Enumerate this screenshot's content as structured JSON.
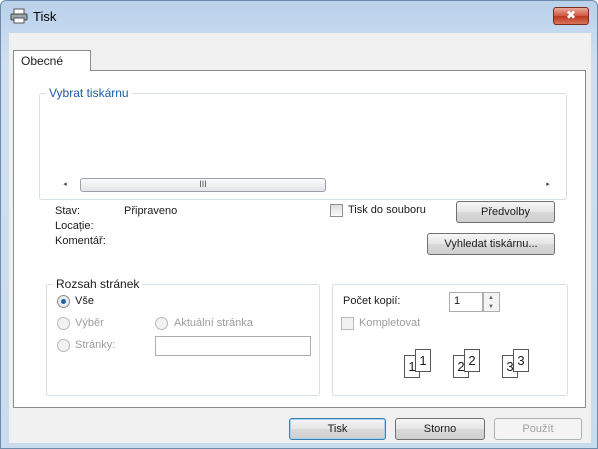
{
  "window": {
    "title": "Tisk",
    "close_symbol": "✖"
  },
  "tabs": [
    {
      "label": "Obecné"
    }
  ],
  "select_printer": {
    "legend": "Vybrat tiskárnu",
    "scroll_thumb": "III",
    "scroll_left": "◂",
    "scroll_right": "▸"
  },
  "status": {
    "stav_label": "Stav:",
    "stav_value": "Připraveno",
    "location_label": "Locație:",
    "comment_label": "Komentář:",
    "print_to_file": "Tisk do souboru",
    "preferences_button": "Předvolby",
    "find_printer_button": "Vyhledat tiskárnu..."
  },
  "page_range": {
    "legend": "Rozsah stránek",
    "all": "Vše",
    "selection": "Výběr",
    "current_page": "Aktuální stránka",
    "pages": "Stránky:",
    "pages_value": ""
  },
  "copies": {
    "label": "Počet kopií:",
    "value": "1",
    "collate": "Kompletovat",
    "collate_pages": [
      "1",
      "1",
      "2",
      "2",
      "3",
      "3"
    ]
  },
  "footer": {
    "print": "Tisk",
    "cancel": "Storno",
    "apply": "Použít"
  }
}
